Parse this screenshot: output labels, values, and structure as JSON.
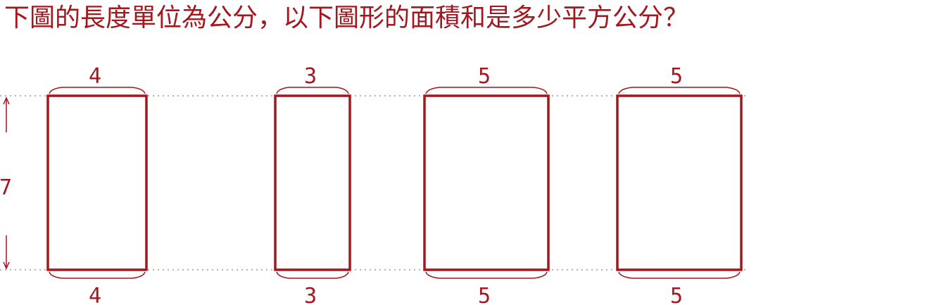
{
  "question": "下圖的長度單位為公分，以下圖形的面積和是多少平方公分？",
  "colors": {
    "main": "#a3171e",
    "guide": "#9a9a9a"
  },
  "height_label": "7",
  "rectangles": [
    {
      "width_label_top": "4",
      "width_label_bottom": "4"
    },
    {
      "width_label_top": "3",
      "width_label_bottom": "3"
    },
    {
      "width_label_top": "5",
      "width_label_bottom": "5"
    },
    {
      "width_label_top": "5",
      "width_label_bottom": "5"
    }
  ]
}
